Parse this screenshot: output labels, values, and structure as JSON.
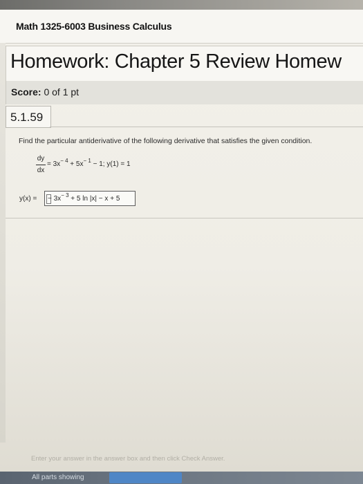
{
  "course": {
    "title": "Math 1325-6003 Business Calculus"
  },
  "homework": {
    "title": "Homework: Chapter 5 Review Homew"
  },
  "score": {
    "label": "Score:",
    "value": "0 of 1 pt"
  },
  "question": {
    "number": "5.1.59",
    "prompt": "Find the particular antiderivative of the following derivative that satisfies the given condition.",
    "equation": {
      "numerator": "dy",
      "denominator": "dx",
      "rhs_parts": {
        "p1": "= 3x",
        "e1": "− 4",
        "p2": " + 5x",
        "e2": "− 1",
        "p3": " − 1;  y(1) = 1"
      }
    },
    "answer": {
      "label": "y(x) =",
      "parts": {
        "p1": "− 3x",
        "e1": "− 3",
        "p2": " + 5 ln |x| − x + 5"
      }
    }
  },
  "footer": {
    "hint": "Enter your answer in the answer box and then click Check Answer.",
    "status": "All parts showing"
  },
  "colors": {
    "accent": "#4f86c6",
    "footer_bar": "#6b7581",
    "background": "#efede6"
  }
}
